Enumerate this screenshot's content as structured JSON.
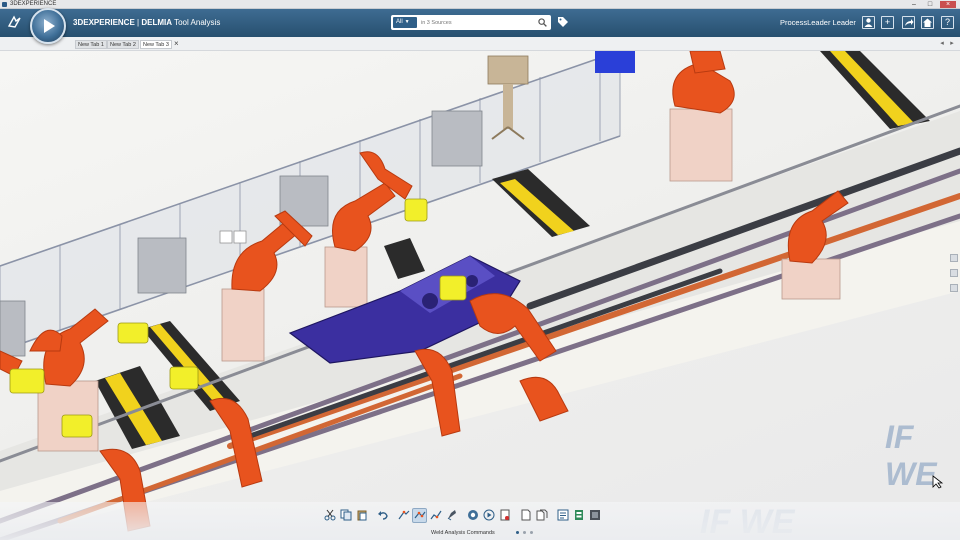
{
  "os_window": {
    "title": "3DEXPERIENCE"
  },
  "header": {
    "brand": "3DEXPERIENCE",
    "separator": " | ",
    "product": "DELMIA",
    "app_name": "Tool Analysis",
    "search": {
      "scope": "All",
      "placeholder": "in 3 Sources"
    },
    "user": "ProcessLeader Leader"
  },
  "tabs": [
    {
      "label": "New Tab 1",
      "active": false
    },
    {
      "label": "New Tab 2",
      "active": false
    },
    {
      "label": "New Tab 3",
      "active": true
    }
  ],
  "viewport": {
    "description_icons": [
      "robot-icon",
      "conveyor-icon",
      "car-body-icon",
      "fence-icon"
    ],
    "watermark": "IF WE"
  },
  "action_bar": {
    "label": "Weld Analysis Commands",
    "page_count": 3,
    "active_page": 1,
    "tools": [
      "cut-icon",
      "copy-icon",
      "paste-icon",
      "undo-icon",
      "weld-gun-icon",
      "weld-spot-icon",
      "weld-path-icon",
      "weld-check-icon",
      "simulate-icon",
      "play-icon",
      "record-icon",
      "sheet-icon",
      "sheet-copy-icon",
      "report-icon",
      "export-icon",
      "capture-icon"
    ]
  },
  "colors": {
    "header": "#2f5f88",
    "robot": "#e8531e",
    "tool": "#f2ef2a",
    "car_body": "#3b2fa0"
  }
}
